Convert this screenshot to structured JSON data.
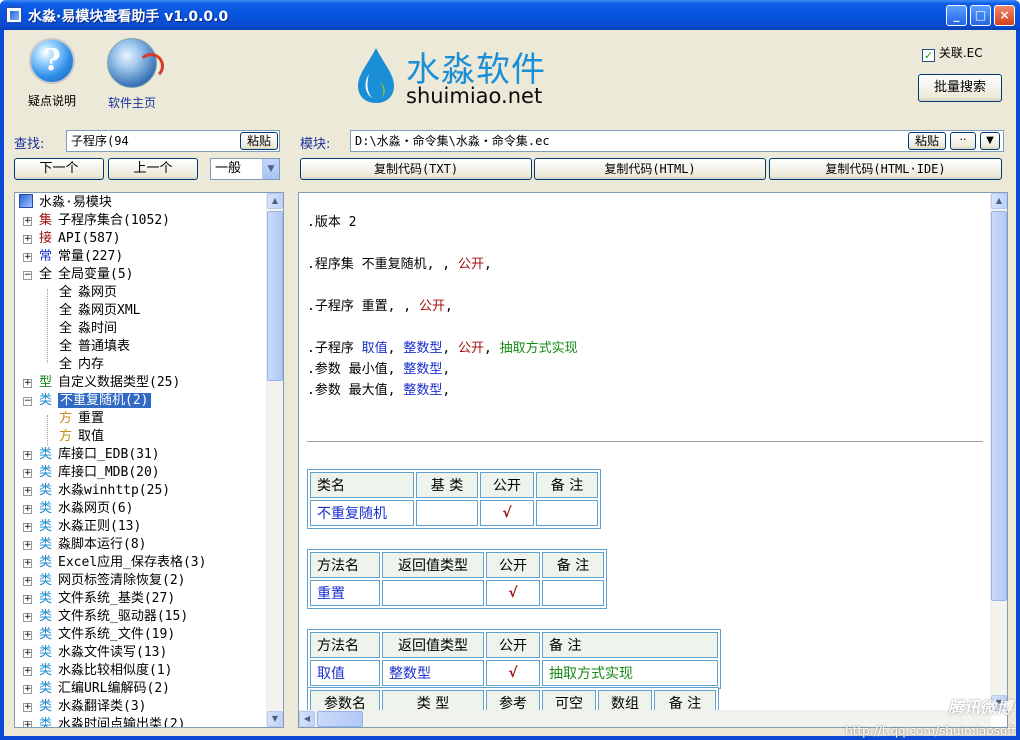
{
  "window": {
    "title": "水淼·易模块查看助手 v1.0.0.0",
    "min": "_",
    "max": "□",
    "close": "×"
  },
  "toolbar": {
    "help_label": "疑点说明",
    "home_label": "软件主页",
    "logo_cn": "水淼软件",
    "logo_en": "shuimiao.net",
    "assoc_label": "关联.EC",
    "assoc_checked": true,
    "batch_search": "批量搜索"
  },
  "search": {
    "label": "查找:",
    "value": "子程序(94",
    "paste": "粘贴",
    "next": "下一个",
    "prev": "上一个",
    "mode": "一般"
  },
  "module": {
    "label": "模块:",
    "path": "D:\\水淼・命令集\\水淼・命令集.ec",
    "paste": "粘贴",
    "more": "··",
    "copy_txt": "复制代码(TXT)",
    "copy_html": "复制代码(HTML)",
    "copy_html_ide": "复制代码(HTML·IDE)"
  },
  "tree": [
    {
      "indent": 0,
      "expander": "",
      "tag": "",
      "text": "水淼·易模块",
      "root": true
    },
    {
      "indent": 0,
      "expander": "+",
      "tag": "集",
      "tag_color": "#a01010",
      "text": "子程序集合(1052)"
    },
    {
      "indent": 0,
      "expander": "+",
      "tag": "接",
      "tag_color": "#a01010",
      "text": "API(587)"
    },
    {
      "indent": 0,
      "expander": "+",
      "tag": "常",
      "tag_color": "#1a2fd0",
      "text": "常量(227)"
    },
    {
      "indent": 0,
      "expander": "-",
      "tag": "全",
      "tag_color": "#000000",
      "text": "全局变量(5)"
    },
    {
      "indent": 1,
      "expander": "",
      "tag": "全",
      "tag_color": "#000000",
      "text": "淼网页"
    },
    {
      "indent": 1,
      "expander": "",
      "tag": "全",
      "tag_color": "#000000",
      "text": "淼网页XML"
    },
    {
      "indent": 1,
      "expander": "",
      "tag": "全",
      "tag_color": "#000000",
      "text": "淼时间"
    },
    {
      "indent": 1,
      "expander": "",
      "tag": "全",
      "tag_color": "#000000",
      "text": "普通填表"
    },
    {
      "indent": 1,
      "expander": "",
      "tag": "全",
      "tag_color": "#000000",
      "text": "内存"
    },
    {
      "indent": 0,
      "expander": "+",
      "tag": "型",
      "tag_color": "#168a16",
      "text": "自定义数据类型(25)"
    },
    {
      "indent": 0,
      "expander": "-",
      "tag": "类",
      "tag_color": "#1a8ad0",
      "text": "不重复随机(2)",
      "selected": true
    },
    {
      "indent": 1,
      "expander": "",
      "tag": "方",
      "tag_color": "#c88a10",
      "text": "重置"
    },
    {
      "indent": 1,
      "expander": "",
      "tag": "方",
      "tag_color": "#c88a10",
      "text": "取值"
    },
    {
      "indent": 0,
      "expander": "+",
      "tag": "类",
      "tag_color": "#1a8ad0",
      "text": "库接口_EDB(31)"
    },
    {
      "indent": 0,
      "expander": "+",
      "tag": "类",
      "tag_color": "#1a8ad0",
      "text": "库接口_MDB(20)"
    },
    {
      "indent": 0,
      "expander": "+",
      "tag": "类",
      "tag_color": "#1a8ad0",
      "text": "水淼winhttp(25)"
    },
    {
      "indent": 0,
      "expander": "+",
      "tag": "类",
      "tag_color": "#1a8ad0",
      "text": "水淼网页(6)"
    },
    {
      "indent": 0,
      "expander": "+",
      "tag": "类",
      "tag_color": "#1a8ad0",
      "text": "水淼正则(13)"
    },
    {
      "indent": 0,
      "expander": "+",
      "tag": "类",
      "tag_color": "#1a8ad0",
      "text": "淼脚本运行(8)"
    },
    {
      "indent": 0,
      "expander": "+",
      "tag": "类",
      "tag_color": "#1a8ad0",
      "text": "Excel应用_保存表格(3)"
    },
    {
      "indent": 0,
      "expander": "+",
      "tag": "类",
      "tag_color": "#1a8ad0",
      "text": "网页标签清除恢复(2)"
    },
    {
      "indent": 0,
      "expander": "+",
      "tag": "类",
      "tag_color": "#1a8ad0",
      "text": "文件系统_基类(27)"
    },
    {
      "indent": 0,
      "expander": "+",
      "tag": "类",
      "tag_color": "#1a8ad0",
      "text": "文件系统_驱动器(15)"
    },
    {
      "indent": 0,
      "expander": "+",
      "tag": "类",
      "tag_color": "#1a8ad0",
      "text": "文件系统_文件(19)"
    },
    {
      "indent": 0,
      "expander": "+",
      "tag": "类",
      "tag_color": "#1a8ad0",
      "text": "水淼文件读写(13)"
    },
    {
      "indent": 0,
      "expander": "+",
      "tag": "类",
      "tag_color": "#1a8ad0",
      "text": "水淼比较相似度(1)"
    },
    {
      "indent": 0,
      "expander": "+",
      "tag": "类",
      "tag_color": "#1a8ad0",
      "text": "汇编URL编解码(2)"
    },
    {
      "indent": 0,
      "expander": "+",
      "tag": "类",
      "tag_color": "#1a8ad0",
      "text": "水淼翻译类(3)"
    },
    {
      "indent": 0,
      "expander": "+",
      "tag": "类",
      "tag_color": "#1a8ad0",
      "text": "水淼时间点输出类(2)"
    }
  ],
  "code": {
    "line1": ".版本 2",
    "line2_a": ".程序集 不重复随机, , ",
    "line2_b": "公开",
    "line3_a": ".子程序 重置, , ",
    "line3_b": "公开",
    "line4_a": ".子程序 ",
    "line4_b": "取值",
    "line4_c": ", ",
    "line4_d": "整数型",
    "line4_e": ", ",
    "line4_f": "公开",
    "line4_g": ", ",
    "line4_h": "抽取方式实现",
    "line5_a": ".参数 最小值, ",
    "line5_b": "整数型",
    "line5_c": ",",
    "line6_a": ".参数 最大值, ",
    "line6_b": "整数型",
    "line6_c": ","
  },
  "table_class": {
    "headers": [
      "类名",
      "基 类",
      "公开",
      "备 注"
    ],
    "row": [
      "不重复随机",
      "",
      "√",
      ""
    ]
  },
  "table_method1": {
    "headers": [
      "方法名",
      "返回值类型",
      "公开",
      "备 注"
    ],
    "row": [
      "重置",
      "",
      "√",
      ""
    ]
  },
  "table_method2": {
    "headers": [
      "方法名",
      "返回值类型",
      "公开",
      "备 注"
    ],
    "row": [
      "取值",
      "整数型",
      "√",
      "抽取方式实现"
    ],
    "param_headers": [
      "参数名",
      "类 型",
      "参考",
      "可空",
      "数组",
      "备 注"
    ]
  },
  "watermark": {
    "brand": "腾讯微博",
    "url": "http://t.qq.com/shuimiaosoft"
  }
}
